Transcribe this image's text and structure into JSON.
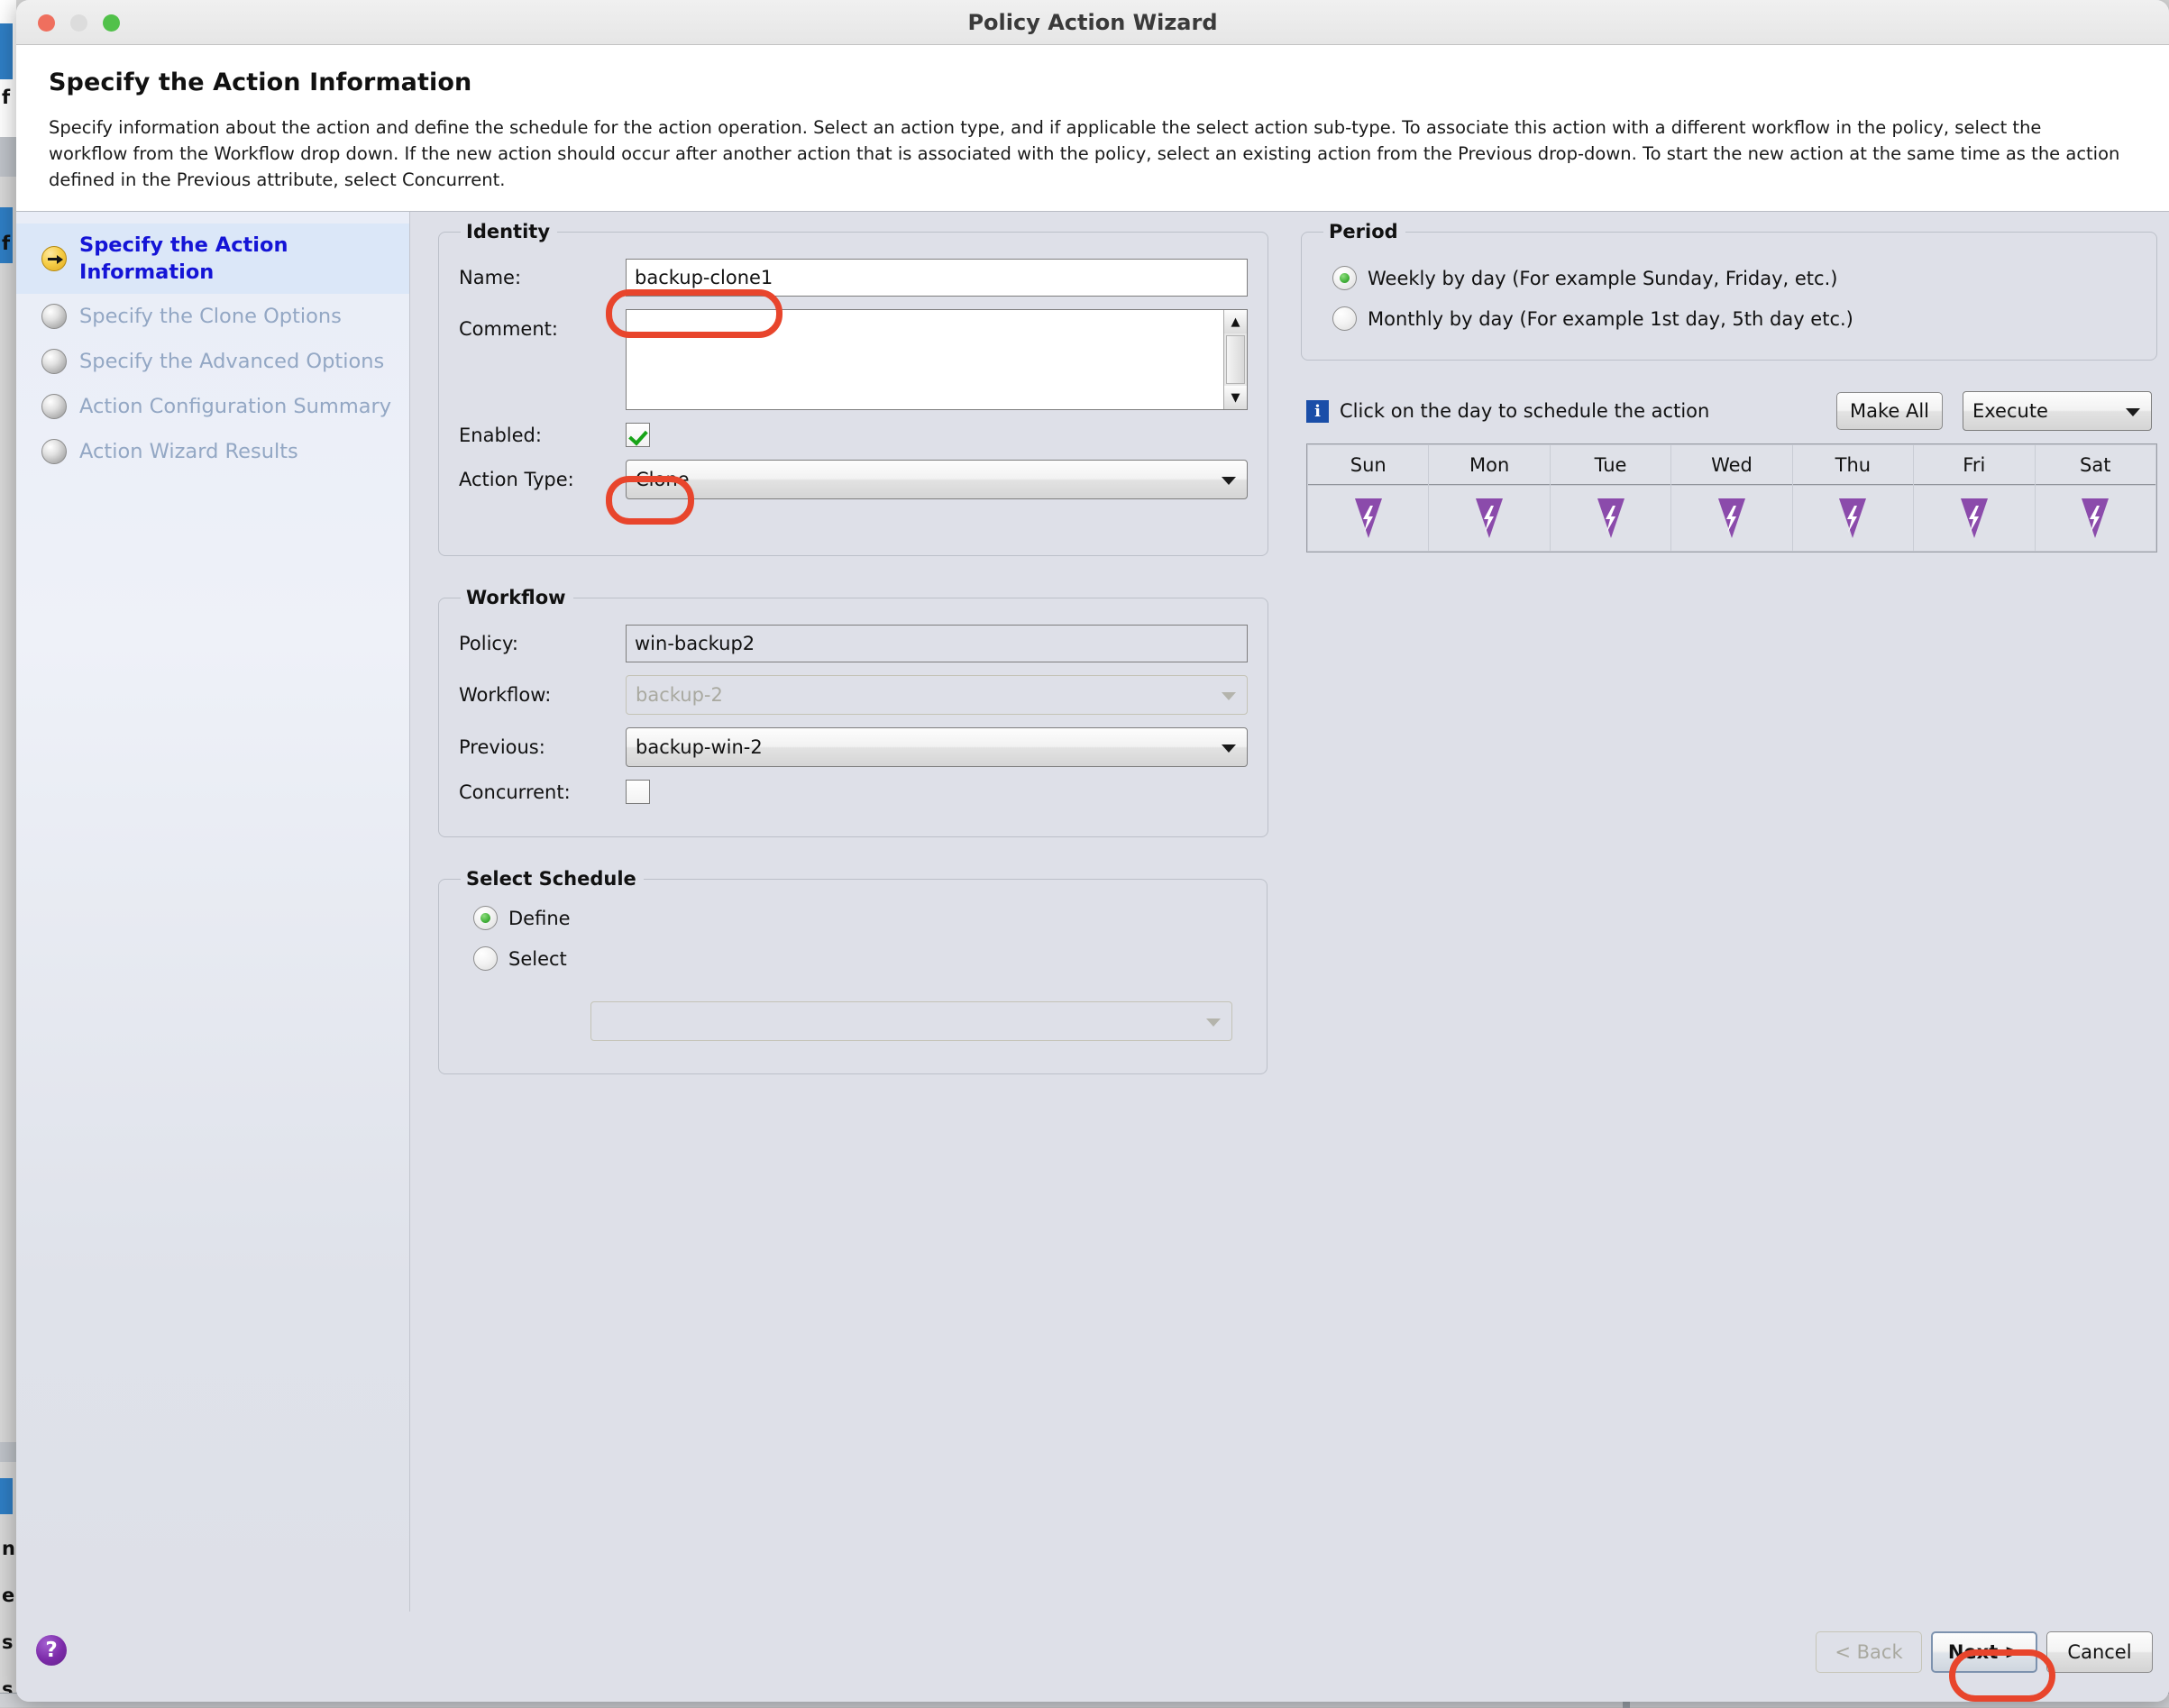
{
  "window": {
    "title": "Policy Action Wizard",
    "traffic_lights": [
      "close",
      "minimize",
      "zoom"
    ]
  },
  "header": {
    "title": "Specify the Action Information",
    "description": "Specify information about the action and define the schedule for the action operation. Select an action type, and if applicable the select action sub-type. To associate this action with a different workflow in the policy, select the workflow from the Workflow drop down. If the new action should occur after another action that is associated with the policy, select an existing action from the Previous drop-down. To start the new action at the same time as the action defined in the Previous attribute, select Concurrent."
  },
  "steps": [
    {
      "label": "Specify the Action Information",
      "state": "active",
      "icon": "arrow-bullet-icon"
    },
    {
      "label": "Specify the Clone Options",
      "state": "pending",
      "icon": "sphere-bullet-icon"
    },
    {
      "label": "Specify the Advanced Options",
      "state": "pending",
      "icon": "sphere-bullet-icon"
    },
    {
      "label": "Action Configuration Summary",
      "state": "pending",
      "icon": "sphere-bullet-icon"
    },
    {
      "label": "Action Wizard Results",
      "state": "pending",
      "icon": "sphere-bullet-icon"
    }
  ],
  "identity": {
    "legend": "Identity",
    "name_label": "Name:",
    "name_value": "backup-clone1",
    "name_placeholder": "",
    "comment_label": "Comment:",
    "comment_value": "",
    "comment_placeholder": "",
    "enabled_label": "Enabled:",
    "enabled_checked": true,
    "action_type_label": "Action Type:",
    "action_type_value": "Clone"
  },
  "workflow": {
    "legend": "Workflow",
    "policy_label": "Policy:",
    "policy_value": "win-backup2",
    "workflow_label": "Workflow:",
    "workflow_value": "backup-2",
    "previous_label": "Previous:",
    "previous_value": "backup-win-2",
    "concurrent_label": "Concurrent:",
    "concurrent_checked": false
  },
  "schedule": {
    "legend": "Select Schedule",
    "define_label": "Define",
    "select_label": "Select",
    "selected": "Define",
    "schedule_combo_value": ""
  },
  "period": {
    "legend": "Period",
    "weekly_label": "Weekly by day  (For example Sunday, Friday, etc.)",
    "monthly_label": "Monthly by day (For example 1st day, 5th day etc.)",
    "selected": "Weekly by day"
  },
  "day_scheduler": {
    "hint": "Click on the day to schedule the action",
    "info_icon": "info-icon",
    "make_all_label": "Make All",
    "execute_label": "Execute",
    "days": [
      {
        "name": "Sun",
        "icon": "lightning-bolt-icon",
        "scheduled": true
      },
      {
        "name": "Mon",
        "icon": "lightning-bolt-icon",
        "scheduled": true
      },
      {
        "name": "Tue",
        "icon": "lightning-bolt-icon",
        "scheduled": true
      },
      {
        "name": "Wed",
        "icon": "lightning-bolt-icon",
        "scheduled": true
      },
      {
        "name": "Thu",
        "icon": "lightning-bolt-icon",
        "scheduled": true
      },
      {
        "name": "Fri",
        "icon": "lightning-bolt-icon",
        "scheduled": true
      },
      {
        "name": "Sat",
        "icon": "lightning-bolt-icon",
        "scheduled": true
      }
    ]
  },
  "footer": {
    "help_icon": "help-icon",
    "help_glyph": "?",
    "back_label": "< Back",
    "back_disabled": true,
    "next_label": "Next >",
    "cancel_label": "Cancel"
  },
  "colors": {
    "annotation": "#e8452c",
    "accent_purple": "#7b2aa8",
    "active_step_text": "#1414d6",
    "panel_bg": "#dee0e8",
    "info_badge": "#1a4ea8",
    "check_green": "#17a417"
  },
  "background_text": {
    "fragments": [
      "f",
      "n",
      "e",
      "s",
      "s"
    ]
  }
}
